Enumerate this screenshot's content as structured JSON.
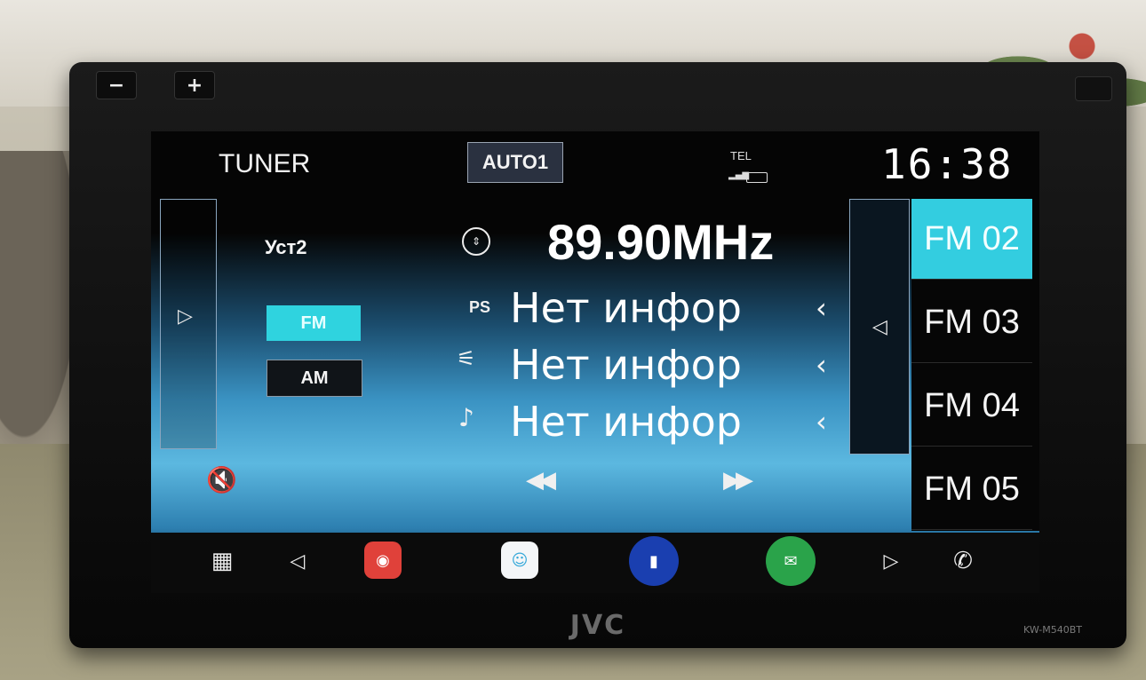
{
  "device": {
    "brand": "JVC",
    "model": "KW-M540BT",
    "vol_down": "−",
    "vol_up": "+"
  },
  "header": {
    "source_title": "TUNER",
    "auto_button": "AUTO1",
    "tel_label": "TEL",
    "clock": "16:38"
  },
  "tuner": {
    "preset_label": "Уст2",
    "bands": [
      "FM",
      "AM"
    ],
    "active_band": "FM",
    "frequency": "89.90MHz",
    "info_rows": [
      {
        "icon": "ps-icon",
        "icon_text": "PS",
        "text": "Нет инфор"
      },
      {
        "icon": "radio-text-icon",
        "icon_text": "📻",
        "text": "Нет инфор"
      },
      {
        "icon": "artist-icon",
        "icon_text": "♪",
        "text": "Нет инфор"
      }
    ]
  },
  "presets": {
    "items": [
      "FM 02",
      "FM 03",
      "FM 04",
      "FM 05"
    ],
    "selected": "FM 02"
  },
  "dock": {
    "icons": [
      "apps-grid-icon",
      "back-icon",
      "app-red-icon",
      "app-waze-icon",
      "app-blue-icon",
      "app-green-icon",
      "forward-icon",
      "phone-icon"
    ]
  },
  "colors": {
    "accent": "#33cde0",
    "screen_bg": "#050505",
    "gradient_blue": "#3a92c2"
  }
}
